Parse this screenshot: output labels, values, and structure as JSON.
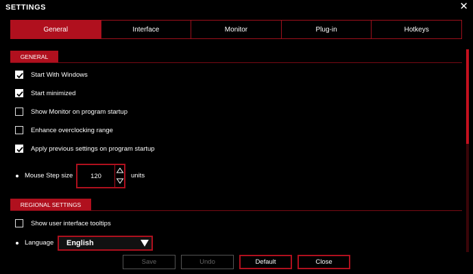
{
  "window": {
    "title": "SETTINGS",
    "close_symbol": "✕"
  },
  "tabs": [
    {
      "label": "General",
      "active": true
    },
    {
      "label": "Interface",
      "active": false
    },
    {
      "label": "Monitor",
      "active": false
    },
    {
      "label": "Plug-in",
      "active": false
    },
    {
      "label": "Hotkeys",
      "active": false
    }
  ],
  "general": {
    "header": "GENERAL",
    "options": [
      {
        "label": "Start With Windows",
        "checked": true
      },
      {
        "label": "Start minimized",
        "checked": true
      },
      {
        "label": "Show Monitor on program startup",
        "checked": false
      },
      {
        "label": "Enhance overclocking range",
        "checked": false
      },
      {
        "label": "Apply previous settings on program startup",
        "checked": true
      }
    ],
    "mouse_step": {
      "label": "Mouse Step size",
      "value": "120",
      "units": "units"
    }
  },
  "regional": {
    "header": "REGIONAL SETTINGS",
    "tooltips_label": "Show user interface tooltips",
    "tooltips_checked": false,
    "language_label": "Language",
    "language_value": "English"
  },
  "footer": {
    "save_label": "Save",
    "undo_label": "Undo",
    "default_label": "Default",
    "close_label": "Close"
  },
  "colors": {
    "accent": "#b0101e",
    "background": "#000000",
    "text": "#ffffff",
    "disabled": "#666666"
  },
  "icons": {
    "close": "close-icon",
    "checkmark": "checkmark-icon",
    "up": "chevron-up-icon",
    "down": "chevron-down-icon",
    "caret": "caret-down-icon"
  }
}
